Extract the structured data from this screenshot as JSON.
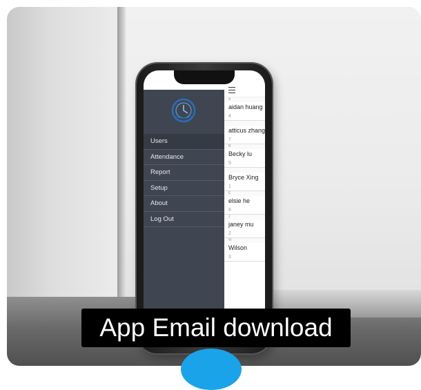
{
  "drawer": {
    "logo": "clock-logo-icon",
    "items": [
      {
        "label": "Users",
        "active": true
      },
      {
        "label": "Attendance",
        "active": false
      },
      {
        "label": "Report",
        "active": false
      },
      {
        "label": "Setup",
        "active": false
      },
      {
        "label": "About",
        "active": false
      },
      {
        "label": "Log Out",
        "active": false
      }
    ]
  },
  "list": {
    "menu_icon": "hamburger-icon",
    "contacts": [
      {
        "letter": "A",
        "name": "aidan huang",
        "count": "4"
      },
      {
        "letter": "",
        "name": "atticus zhang",
        "count": "7"
      },
      {
        "letter": "B",
        "name": "Becky lu",
        "count": "5"
      },
      {
        "letter": "",
        "name": "Bryce Xing",
        "count": "1"
      },
      {
        "letter": "E",
        "name": "elsie he",
        "count": "6"
      },
      {
        "letter": "J",
        "name": "janey mu",
        "count": "2"
      },
      {
        "letter": "W",
        "name": "Wilson",
        "count": "3"
      }
    ]
  },
  "caption": "App Email download",
  "colors": {
    "drawer_bg": "#3f4651",
    "caption_bg": "#000000",
    "accent_blue": "#1aa3e8"
  }
}
